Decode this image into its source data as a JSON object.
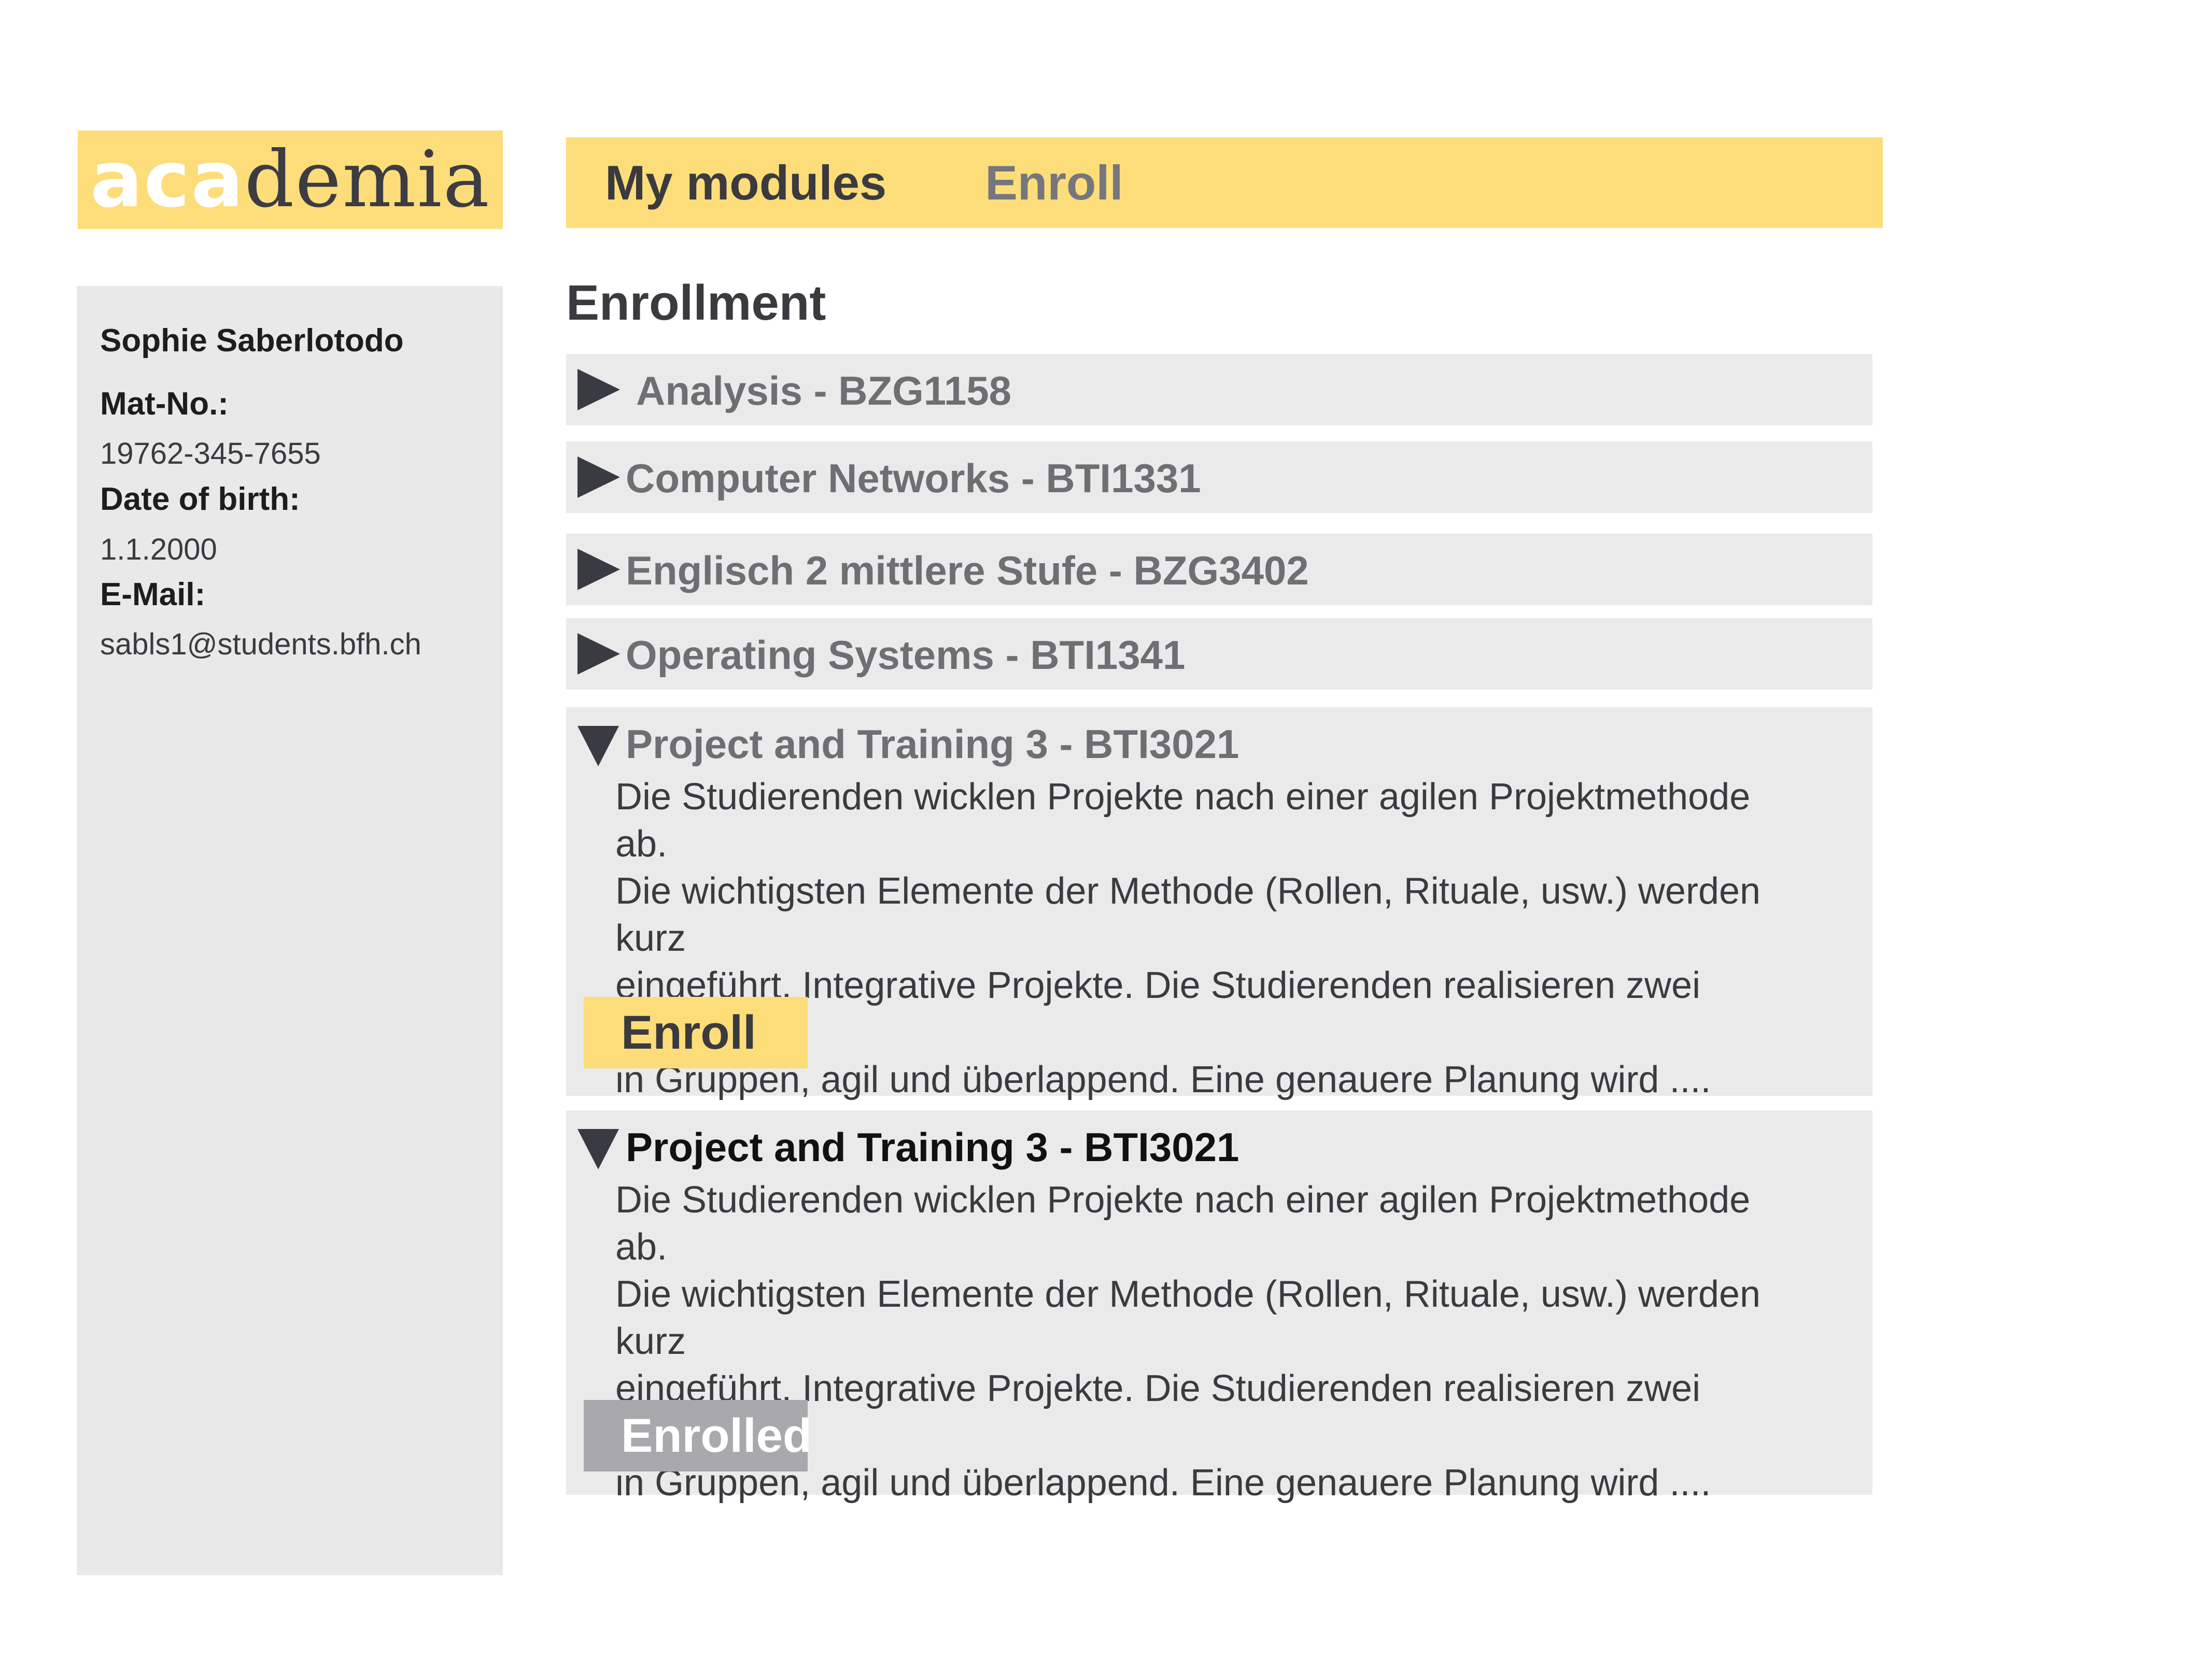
{
  "logo": {
    "part1": "aca",
    "part2": "demia"
  },
  "sidebar": {
    "name": "Sophie Saberlotodo",
    "mat_label": "Mat-No.:",
    "mat_value": "19762-345-7655",
    "dob_label": "Date of birth:",
    "dob_value": "1.1.2000",
    "email_label": "E-Mail:",
    "email_value": "sabls1@students.bfh.ch"
  },
  "nav": {
    "my_modules": "My modules",
    "enroll": "Enroll"
  },
  "page": {
    "heading": "Enrollment"
  },
  "modules": [
    {
      "title": "Analysis - BZG1158",
      "expanded": false
    },
    {
      "title": "Computer Networks - BTI1331",
      "expanded": false
    },
    {
      "title": "Englisch 2 mittlere Stufe - BZG3402",
      "expanded": false
    },
    {
      "title": "Operating Systems - BTI1341",
      "expanded": false
    },
    {
      "title": "Project and Training 3 - BTI3021",
      "expanded": true,
      "desc": [
        "Die Studierenden wicklen Projekte nach einer agilen Projektmethode ab.",
        "Die wichtigsten Elemente der Methode (Rollen, Rituale, usw.) werden kurz",
        "eingeführt. Integrative Projekte. Die Studierenden realisieren zwei Projekte",
        "in Gruppen, agil und überlappend. Eine genauere Planung wird ...."
      ],
      "button": "Enroll"
    },
    {
      "title": "Project and Training 3 - BTI3021",
      "expanded": true,
      "desc": [
        "Die Studierenden wicklen Projekte nach einer agilen Projektmethode ab.",
        "Die wichtigsten Elemente der Methode (Rollen, Rituale, usw.) werden kurz",
        "eingeführt. Integrative Projekte. Die Studierenden realisieren zwei Projekte",
        "in Gruppen, agil und überlappend. Eine genauere Planung wird ...."
      ],
      "button": "Enrolled"
    }
  ],
  "colors": {
    "accent": "#fcdd79",
    "panel": "#eaeaea",
    "disabled": "#a9a9ad",
    "text": "#3a3a3f"
  },
  "icons": {
    "collapsed": "triangle-right-icon",
    "expanded": "triangle-down-icon"
  }
}
